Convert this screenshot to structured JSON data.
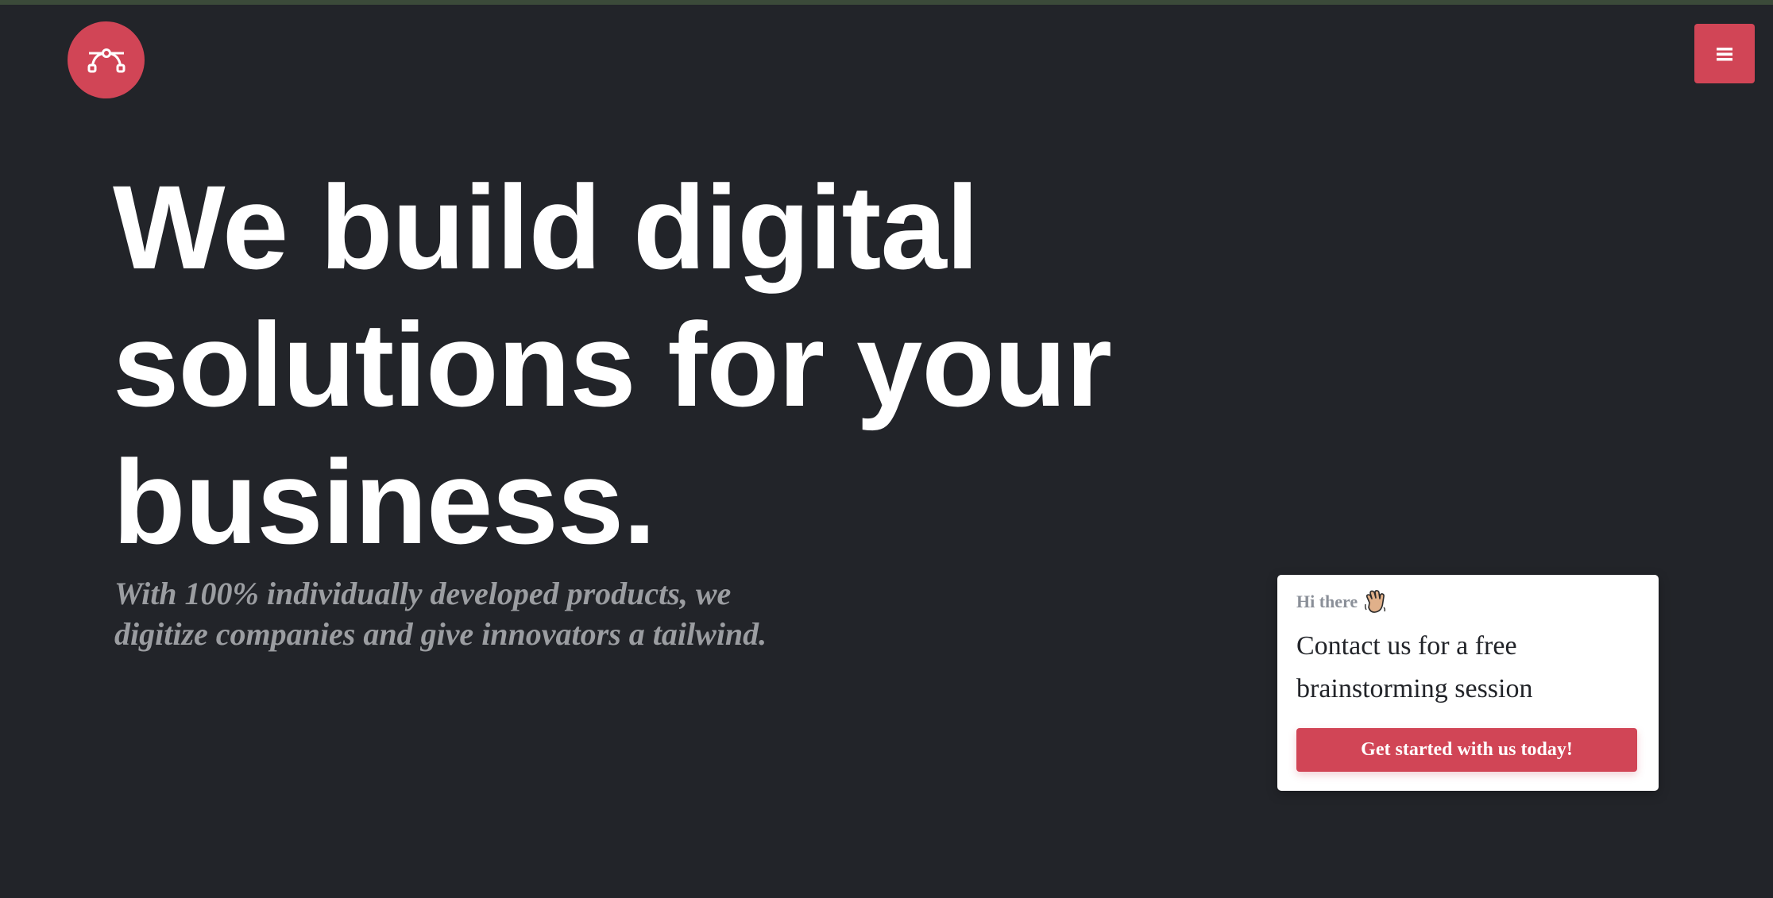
{
  "brand": {
    "logo_icon": "bezier-curve-icon",
    "accent_color": "#d14556"
  },
  "nav": {
    "menu_icon": "hamburger-menu-icon"
  },
  "hero": {
    "title_line1": "We build digital",
    "title_line2": "solutions for your",
    "title_line3": "business.",
    "subtitle_line1": "With 100% individually developed products, we",
    "subtitle_line2": "digitize companies and give innovators a tailwind."
  },
  "contact_card": {
    "greeting": "Hi there",
    "greeting_icon": "waving-hand-icon",
    "message_line1": "Contact us for a free",
    "message_line2": "brainstorming session",
    "cta_label": "Get started with us today!"
  },
  "colors": {
    "background": "#222429",
    "card": "#ffffff",
    "subtitle": "#9b9da1"
  }
}
